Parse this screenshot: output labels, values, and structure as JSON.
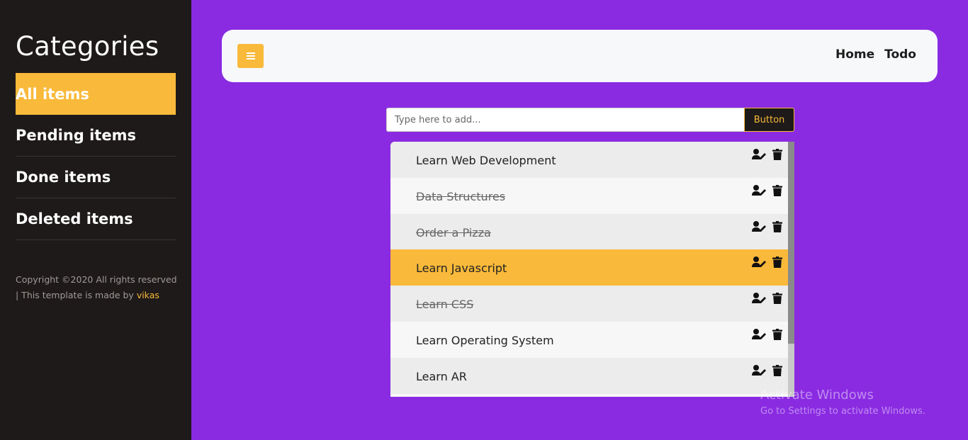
{
  "sidebar": {
    "title": "Categories",
    "items": [
      {
        "label": "All items",
        "active": true
      },
      {
        "label": "Pending items",
        "active": false
      },
      {
        "label": "Done items",
        "active": false
      },
      {
        "label": "Deleted items",
        "active": false
      }
    ],
    "copyright_text": "Copyright ©2020 All rights reserved | This template is made by ",
    "copyright_author": "vikas"
  },
  "navbar": {
    "toggle_icon": "menu-icon",
    "links": [
      "Home",
      "Todo"
    ]
  },
  "add_form": {
    "placeholder": "Type here to add...",
    "button_label": "Button"
  },
  "todos": [
    {
      "text": "Learn Web Development",
      "done": false,
      "highlight": false
    },
    {
      "text": "Data Structures",
      "done": true,
      "highlight": false
    },
    {
      "text": "Order a Pizza",
      "done": true,
      "highlight": false
    },
    {
      "text": "Learn Javascript",
      "done": false,
      "highlight": true
    },
    {
      "text": "Learn CSS",
      "done": true,
      "highlight": false
    },
    {
      "text": "Learn Operating System",
      "done": false,
      "highlight": false
    },
    {
      "text": "Learn AR",
      "done": false,
      "highlight": false
    }
  ],
  "todo_icons": [
    "user-edit-icon",
    "trash-icon"
  ],
  "watermark": {
    "title": "Activate Windows",
    "subtitle": "Go to Settings to activate Windows."
  },
  "colors": {
    "background": "#8a2be2",
    "sidebar": "#1e1a19",
    "accent": "#f9b93a"
  }
}
